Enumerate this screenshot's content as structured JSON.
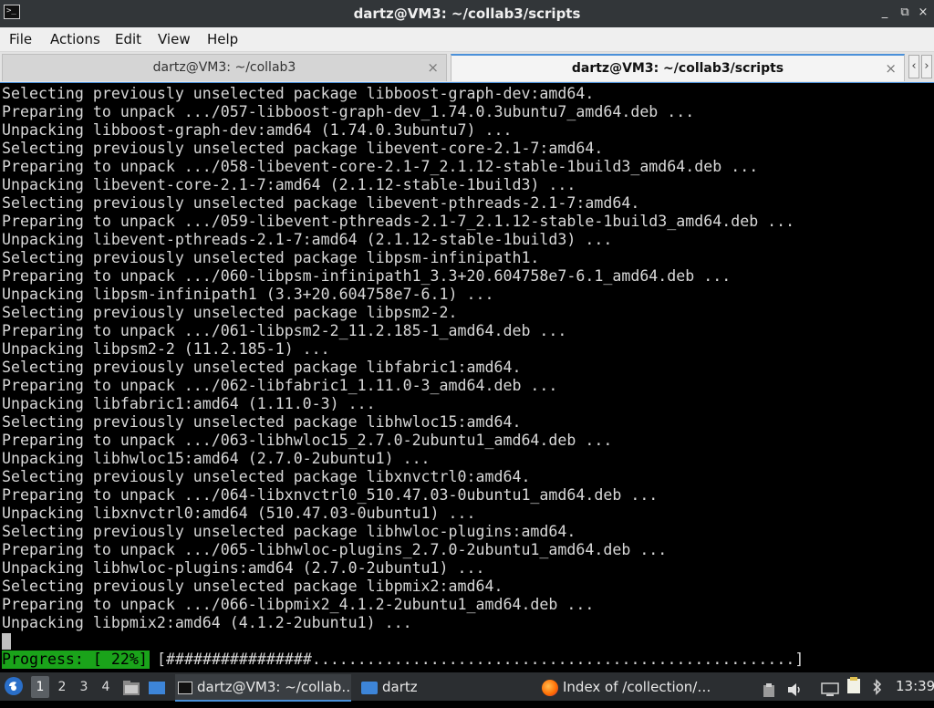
{
  "window": {
    "title": "dartz@VM3: ~/collab3/scripts",
    "controls": {
      "minimize": "_",
      "restore": "⧉",
      "close": "×"
    }
  },
  "menu": [
    "File",
    "Actions",
    "Edit",
    "View",
    "Help"
  ],
  "tabs": [
    {
      "label": "dartz@VM3: ~/collab3",
      "active": false
    },
    {
      "label": "dartz@VM3: ~/collab3/scripts",
      "active": true
    }
  ],
  "tab_nav": {
    "prev": "‹",
    "next": "›"
  },
  "terminal": {
    "lines": [
      "Selecting previously unselected package libboost-graph-dev:amd64.",
      "Preparing to unpack .../057-libboost-graph-dev_1.74.0.3ubuntu7_amd64.deb ...",
      "Unpacking libboost-graph-dev:amd64 (1.74.0.3ubuntu7) ...",
      "Selecting previously unselected package libevent-core-2.1-7:amd64.",
      "Preparing to unpack .../058-libevent-core-2.1-7_2.1.12-stable-1build3_amd64.deb ...",
      "Unpacking libevent-core-2.1-7:amd64 (2.1.12-stable-1build3) ...",
      "Selecting previously unselected package libevent-pthreads-2.1-7:amd64.",
      "Preparing to unpack .../059-libevent-pthreads-2.1-7_2.1.12-stable-1build3_amd64.deb ...",
      "Unpacking libevent-pthreads-2.1-7:amd64 (2.1.12-stable-1build3) ...",
      "Selecting previously unselected package libpsm-infinipath1.",
      "Preparing to unpack .../060-libpsm-infinipath1_3.3+20.604758e7-6.1_amd64.deb ...",
      "Unpacking libpsm-infinipath1 (3.3+20.604758e7-6.1) ...",
      "Selecting previously unselected package libpsm2-2.",
      "Preparing to unpack .../061-libpsm2-2_11.2.185-1_amd64.deb ...",
      "Unpacking libpsm2-2 (11.2.185-1) ...",
      "Selecting previously unselected package libfabric1:amd64.",
      "Preparing to unpack .../062-libfabric1_1.11.0-3_amd64.deb ...",
      "Unpacking libfabric1:amd64 (1.11.0-3) ...",
      "Selecting previously unselected package libhwloc15:amd64.",
      "Preparing to unpack .../063-libhwloc15_2.7.0-2ubuntu1_amd64.deb ...",
      "Unpacking libhwloc15:amd64 (2.7.0-2ubuntu1) ...",
      "Selecting previously unselected package libxnvctrl0:amd64.",
      "Preparing to unpack .../064-libxnvctrl0_510.47.03-0ubuntu1_amd64.deb ...",
      "Unpacking libxnvctrl0:amd64 (510.47.03-0ubuntu1) ...",
      "Selecting previously unselected package libhwloc-plugins:amd64.",
      "Preparing to unpack .../065-libhwloc-plugins_2.7.0-2ubuntu1_amd64.deb ...",
      "Unpacking libhwloc-plugins:amd64 (2.7.0-2ubuntu1) ...",
      "Selecting previously unselected package libpmix2:amd64.",
      "Preparing to unpack .../066-libpmix2_4.1.2-2ubuntu1_amd64.deb ...",
      "Unpacking libpmix2:amd64 (4.1.2-2ubuntu1) ..."
    ],
    "progress_label": "Progress: [ 22%]",
    "progress_bar": "[################.....................................................]",
    "progress_percent": 22
  },
  "taskbar": {
    "workspaces": [
      "1",
      "2",
      "3",
      "4"
    ],
    "active_workspace": "1",
    "tasks": [
      {
        "label": "dartz@VM3: ~/collab…",
        "icon": "terminal-icon",
        "active": true
      },
      {
        "label": "dartz",
        "icon": "folder-icon",
        "active": false
      },
      {
        "label": "Index of /collection/…",
        "icon": "firefox-icon",
        "active": false
      }
    ],
    "clock": "13:39"
  }
}
